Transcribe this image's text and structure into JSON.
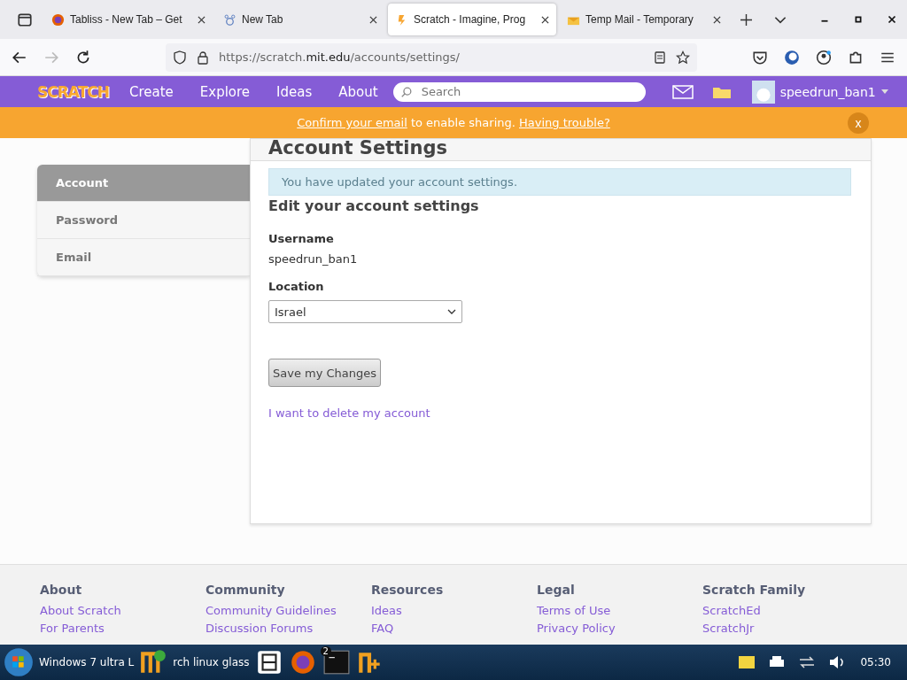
{
  "browser": {
    "tabs": [
      {
        "title": "Tabliss - New Tab – Get",
        "selected": false
      },
      {
        "title": "New Tab",
        "selected": false
      },
      {
        "title": "Scratch - Imagine, Prog",
        "selected": true
      },
      {
        "title": "Temp Mail - Temporary",
        "selected": false
      }
    ],
    "url_host": "https://scratch.",
    "url_domain": "mit.edu",
    "url_path": "/accounts/settings/"
  },
  "nav": {
    "logo": "SCRATCH",
    "links": [
      "Create",
      "Explore",
      "Ideas",
      "About"
    ],
    "search": {
      "placeholder": "Search"
    },
    "username": "speedrun_ban1"
  },
  "banner": {
    "link1": "Confirm your email",
    "middle": "to enable sharing.",
    "link2": "Having trouble?",
    "close": "x"
  },
  "sidebar": [
    {
      "label": "Account",
      "selected": true
    },
    {
      "label": "Password",
      "selected": false
    },
    {
      "label": "Email",
      "selected": false
    }
  ],
  "page": {
    "heading": "Account Settings",
    "alert": "You have updated your account settings.",
    "subheading": "Edit your account settings",
    "username_label": "Username",
    "username": "speedrun_ban1",
    "location_label": "Location",
    "location": "Israel",
    "save": "Save my Changes",
    "delete": "I want to delete my account"
  },
  "footer": [
    {
      "heading": "About",
      "links": [
        "About Scratch",
        "For Parents"
      ]
    },
    {
      "heading": "Community",
      "links": [
        "Community Guidelines",
        "Discussion Forums"
      ]
    },
    {
      "heading": "Resources",
      "links": [
        "Ideas",
        "FAQ"
      ]
    },
    {
      "heading": "Legal",
      "links": [
        "Terms of Use",
        "Privacy Policy"
      ]
    },
    {
      "heading": "Scratch Family",
      "links": [
        "ScratchEd",
        "ScratchJr"
      ]
    }
  ],
  "taskbar": {
    "window1": "Windows 7 ultra L",
    "window2": "rch linux glass",
    "badge": "2",
    "clock": "05:30"
  }
}
